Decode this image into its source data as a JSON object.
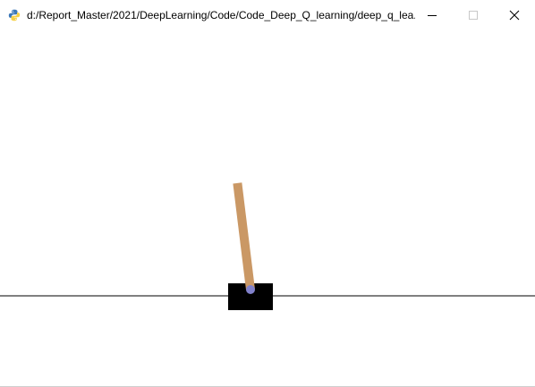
{
  "window": {
    "title": "d:/Report_Master/2021/DeepLearning/Code/Code_Deep_Q_learning/deep_q_lea...",
    "app_icon": "python-icon",
    "controls": {
      "minimize_icon": "minimize-icon",
      "maximize_icon": "maximize-icon",
      "close_icon": "close-icon"
    }
  },
  "scene": {
    "type": "cartpole-render",
    "colors": {
      "background": "#ffffff",
      "track": "#000000",
      "cart": "#000000",
      "pole": "#ca9865",
      "axle": "#8181cb"
    },
    "pole_tilt_degrees": -7
  }
}
